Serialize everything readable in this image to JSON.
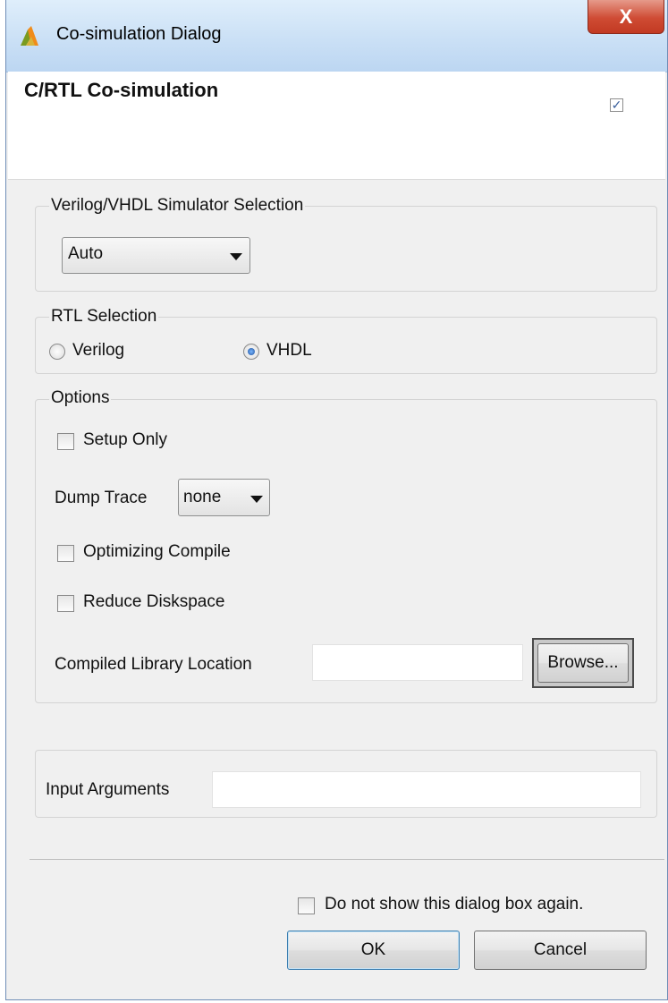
{
  "window": {
    "title": "Co-simulation Dialog",
    "close_label": "X"
  },
  "header": {
    "title": "C/RTL Co-simulation",
    "check_mark": "✓"
  },
  "simulator": {
    "group_label": "Verilog/VHDL Simulator Selection",
    "selected": "Auto"
  },
  "rtl": {
    "group_label": "RTL Selection",
    "options": [
      "Verilog",
      "VHDL"
    ],
    "selected": "VHDL"
  },
  "options": {
    "group_label": "Options",
    "setup_only": "Setup Only",
    "dump_trace_label": "Dump Trace",
    "dump_trace_value": "none",
    "optimizing_compile": "Optimizing Compile",
    "reduce_diskspace": "Reduce Diskspace",
    "library_label": "Compiled Library Location",
    "library_value": "",
    "browse_label": "Browse..."
  },
  "input_args": {
    "label": "Input Arguments",
    "value": ""
  },
  "footer": {
    "dont_show": "Do not show this dialog box again.",
    "ok_label": "OK",
    "cancel_label": "Cancel"
  },
  "icons": {
    "app_logo": "vivado-logo-icon",
    "close": "close-icon",
    "dropdown": "chevron-down-icon"
  },
  "colors": {
    "title_gradient": "#c9dff5",
    "close_red": "#c23a22",
    "accent_blue": "#3c7fb1"
  }
}
